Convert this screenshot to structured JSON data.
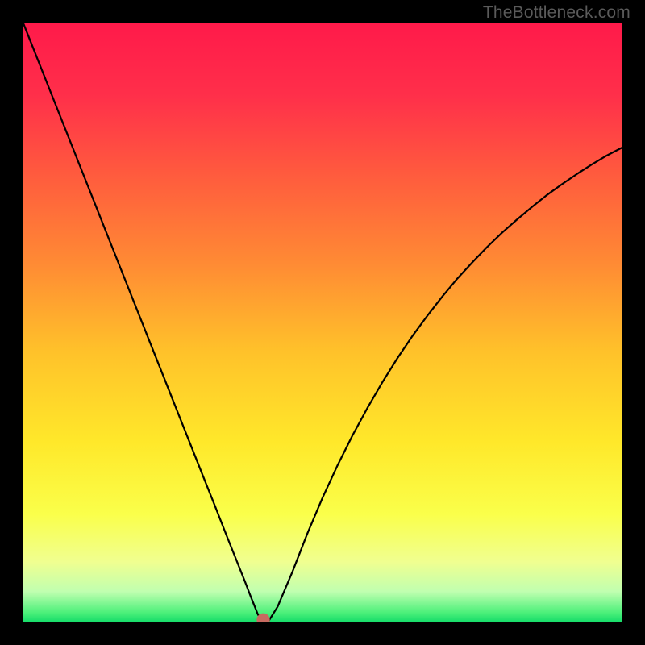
{
  "watermark": "TheBottleneck.com",
  "chart_data": {
    "type": "line",
    "title": "",
    "xlabel": "",
    "ylabel": "",
    "xlim": [
      0,
      100
    ],
    "ylim": [
      0,
      100
    ],
    "grid": false,
    "background": {
      "gradient_stops": [
        {
          "pct": 0.0,
          "color": "#ff1a4a"
        },
        {
          "pct": 0.12,
          "color": "#ff2f4a"
        },
        {
          "pct": 0.25,
          "color": "#ff5a3e"
        },
        {
          "pct": 0.4,
          "color": "#ff8a34"
        },
        {
          "pct": 0.55,
          "color": "#ffc22a"
        },
        {
          "pct": 0.7,
          "color": "#ffe82a"
        },
        {
          "pct": 0.82,
          "color": "#faff4a"
        },
        {
          "pct": 0.9,
          "color": "#f0ff90"
        },
        {
          "pct": 0.95,
          "color": "#c0ffb0"
        },
        {
          "pct": 0.985,
          "color": "#4cf07a"
        },
        {
          "pct": 1.0,
          "color": "#18dd6a"
        }
      ]
    },
    "series": [
      {
        "name": "curve",
        "stroke": "#000000",
        "stroke_width": 2.2,
        "x": [
          0.0,
          2.5,
          5.0,
          7.5,
          10.0,
          12.5,
          15.0,
          17.5,
          20.0,
          22.5,
          25.0,
          27.5,
          30.0,
          32.0,
          34.0,
          36.0,
          37.0,
          38.0,
          38.6,
          39.2,
          39.8,
          40.4,
          41.0,
          42.5,
          45.0,
          47.5,
          50.0,
          52.5,
          55.0,
          57.5,
          60.0,
          62.5,
          65.0,
          67.5,
          70.0,
          72.5,
          75.0,
          77.5,
          80.0,
          82.5,
          85.0,
          87.5,
          90.0,
          92.5,
          95.0,
          97.5,
          100.0
        ],
        "y": [
          100.0,
          93.7,
          87.4,
          81.1,
          74.8,
          68.5,
          62.2,
          55.9,
          49.6,
          43.3,
          37.0,
          30.7,
          24.4,
          19.4,
          14.3,
          9.3,
          6.8,
          4.2,
          2.7,
          1.2,
          0.3,
          0.1,
          0.1,
          2.5,
          8.4,
          14.8,
          20.7,
          26.1,
          31.1,
          35.7,
          40.0,
          44.0,
          47.7,
          51.1,
          54.3,
          57.3,
          60.0,
          62.6,
          65.0,
          67.2,
          69.3,
          71.3,
          73.1,
          74.8,
          76.4,
          77.9,
          79.2
        ]
      }
    ],
    "marker": {
      "x": 40.1,
      "y": 0.3,
      "r": 1.1,
      "fill": "#c76a60"
    }
  }
}
